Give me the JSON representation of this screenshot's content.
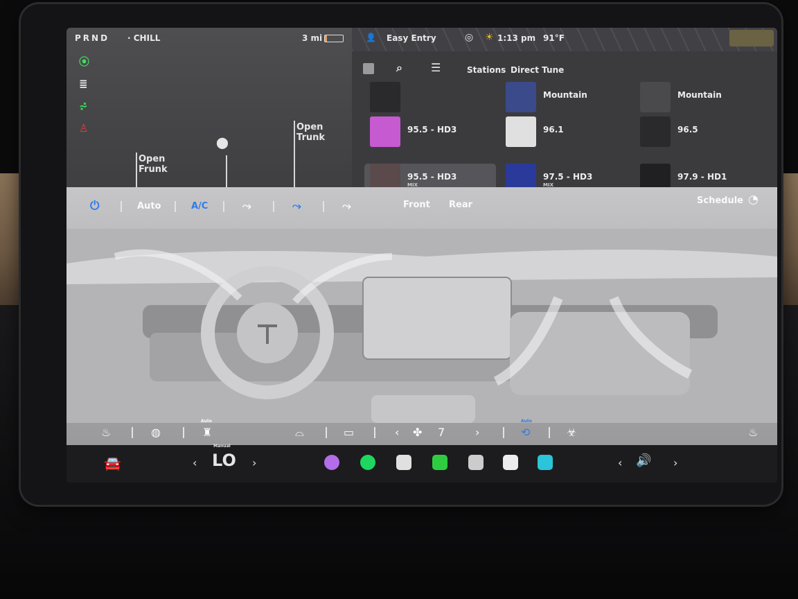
{
  "status": {
    "gear": "PRND",
    "separator": "·",
    "drive_mode": "CHILL",
    "range": "3 mi",
    "battery_level_percent": 10,
    "profile": "Easy Entry",
    "time": "1:13 pm",
    "temperature": "91°F",
    "person_icon": "person-icon",
    "sentry_icon": "sentry-icon",
    "sun_icon": "sun-icon"
  },
  "vehicle": {
    "frunk_label": "Open\nFrunk",
    "trunk_label": "Open\nTrunk",
    "telltales": [
      "headlight-on-icon",
      "high-beam-icon",
      "fog-light-icon",
      "seatbelt-warning-icon"
    ],
    "telltale_colors": [
      "#3fe05a",
      "#e9e9e9",
      "#3fe05a",
      "#e23d3d"
    ]
  },
  "media": {
    "tabs": [
      "Stations",
      "Direct Tune"
    ],
    "stations": [
      {
        "name": "",
        "sub": "",
        "selected": false
      },
      {
        "name": "Mountain",
        "sub": "",
        "selected": false
      },
      {
        "name": "Mountain",
        "sub": "",
        "selected": false
      },
      {
        "name": "95.5 - HD3",
        "sub": "",
        "selected": false
      },
      {
        "name": "96.1",
        "sub": "",
        "selected": false
      },
      {
        "name": "96.5",
        "sub": "",
        "selected": false
      },
      {
        "name": "95.5 - HD3",
        "sub": "MIX",
        "selected": true
      },
      {
        "name": "97.5 - HD3",
        "sub": "MIX",
        "selected": false
      },
      {
        "name": "97.9 - HD1",
        "sub": "",
        "selected": false
      }
    ]
  },
  "climate": {
    "auto": "Auto",
    "ac": "A/C",
    "front": "Front",
    "rear": "Rear",
    "schedule": "Schedule",
    "fan_speed": "7",
    "auto_small": "Auto",
    "power_color": "#2f7be8"
  },
  "dock": {
    "temperature": "LO",
    "temp_label": "Manual",
    "app_colors": [
      "#b36de8",
      "#1ed760",
      "#e0e0e0",
      "#2ecc40",
      "#cccccc",
      "#ececec",
      "#2bc4d8"
    ]
  }
}
